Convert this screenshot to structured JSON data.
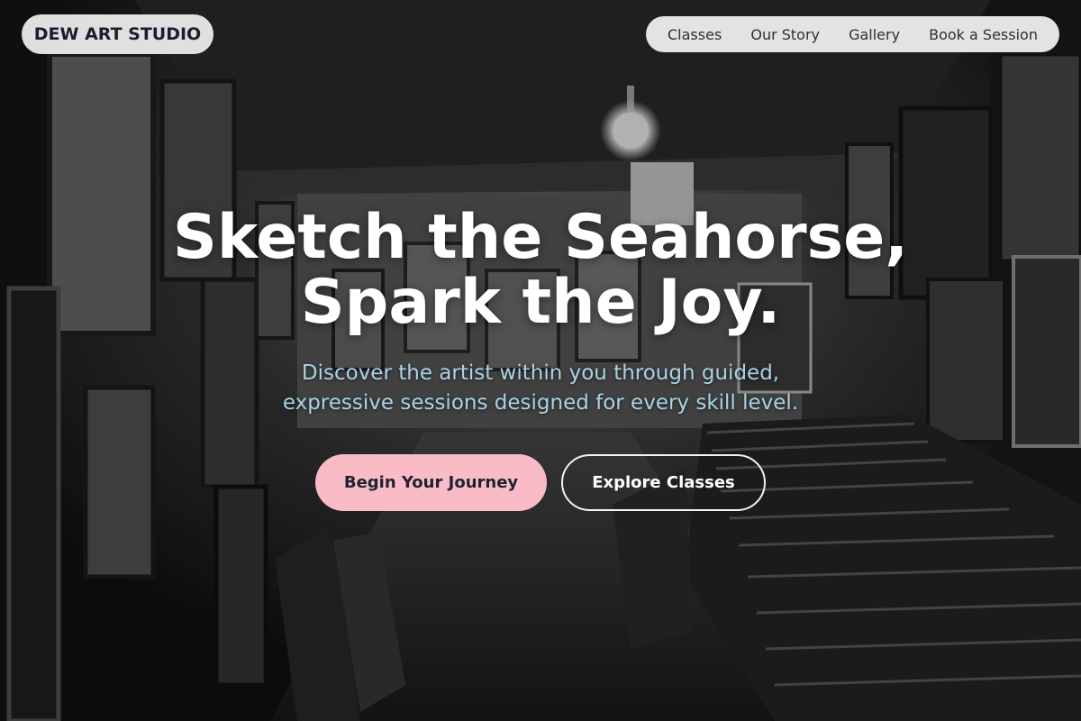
{
  "brand": {
    "name": "DEW ART STUDIO"
  },
  "nav": {
    "items": [
      {
        "label": "Classes"
      },
      {
        "label": "Our Story"
      },
      {
        "label": "Gallery"
      },
      {
        "label": "Book a Session"
      }
    ]
  },
  "hero": {
    "headline_line1": "Sketch the Seahorse,",
    "headline_line2": "Spark the Joy.",
    "subtitle_line1": "Discover the artist within you through guided,",
    "subtitle_line2": "expressive sessions designed for every skill level.",
    "primary_cta": "Begin Your Journey",
    "secondary_cta": "Explore Classes"
  },
  "colors": {
    "primary_button": "#f9bcc6",
    "subtitle_text": "#a9d3e6",
    "pill_background": "#eeeeee"
  }
}
